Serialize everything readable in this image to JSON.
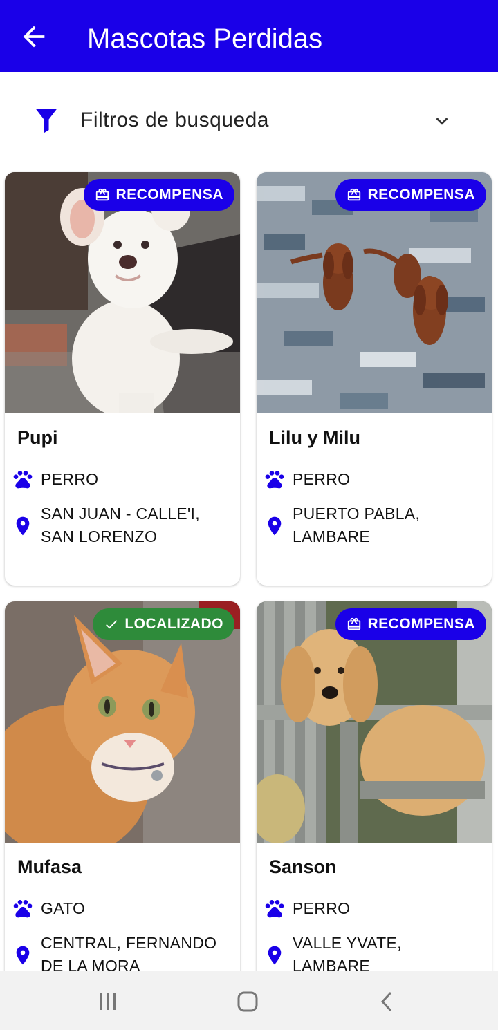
{
  "header": {
    "title": "Mascotas Perdidas"
  },
  "filters": {
    "label": "Filtros de busqueda"
  },
  "colors": {
    "primary": "#1a00e8",
    "found": "#2e8b3a"
  },
  "pets": [
    {
      "name": "Pupi",
      "type": "PERRO",
      "location": "SAN JUAN - CALLE'I, SAN LORENZO",
      "badge": "RECOMPENSA",
      "badge_kind": "reward",
      "photo": "white-puppy"
    },
    {
      "name": "Lilu y Milu",
      "type": "PERRO",
      "location": "PUERTO PABLA, LAMBARE",
      "badge": "RECOMPENSA",
      "badge_kind": "reward",
      "photo": "two-dachshunds"
    },
    {
      "name": "Mufasa",
      "type": "GATO",
      "location": "CENTRAL, FERNANDO DE LA MORA",
      "badge": "LOCALIZADO",
      "badge_kind": "found",
      "photo": "orange-cat"
    },
    {
      "name": "Sanson",
      "type": "PERRO",
      "location": "VALLE YVATE, LAMBARE",
      "badge": "RECOMPENSA",
      "badge_kind": "reward",
      "photo": "golden-retriever"
    }
  ],
  "icons": {
    "back": "arrow-left-icon",
    "filter": "funnel-icon",
    "expand": "chevron-down-icon",
    "reward": "gift-icon",
    "found": "check-icon",
    "type": "paw-icon",
    "location": "map-pin-icon",
    "nav_recents": "recents-icon",
    "nav_home": "home-icon",
    "nav_back": "back-icon"
  }
}
